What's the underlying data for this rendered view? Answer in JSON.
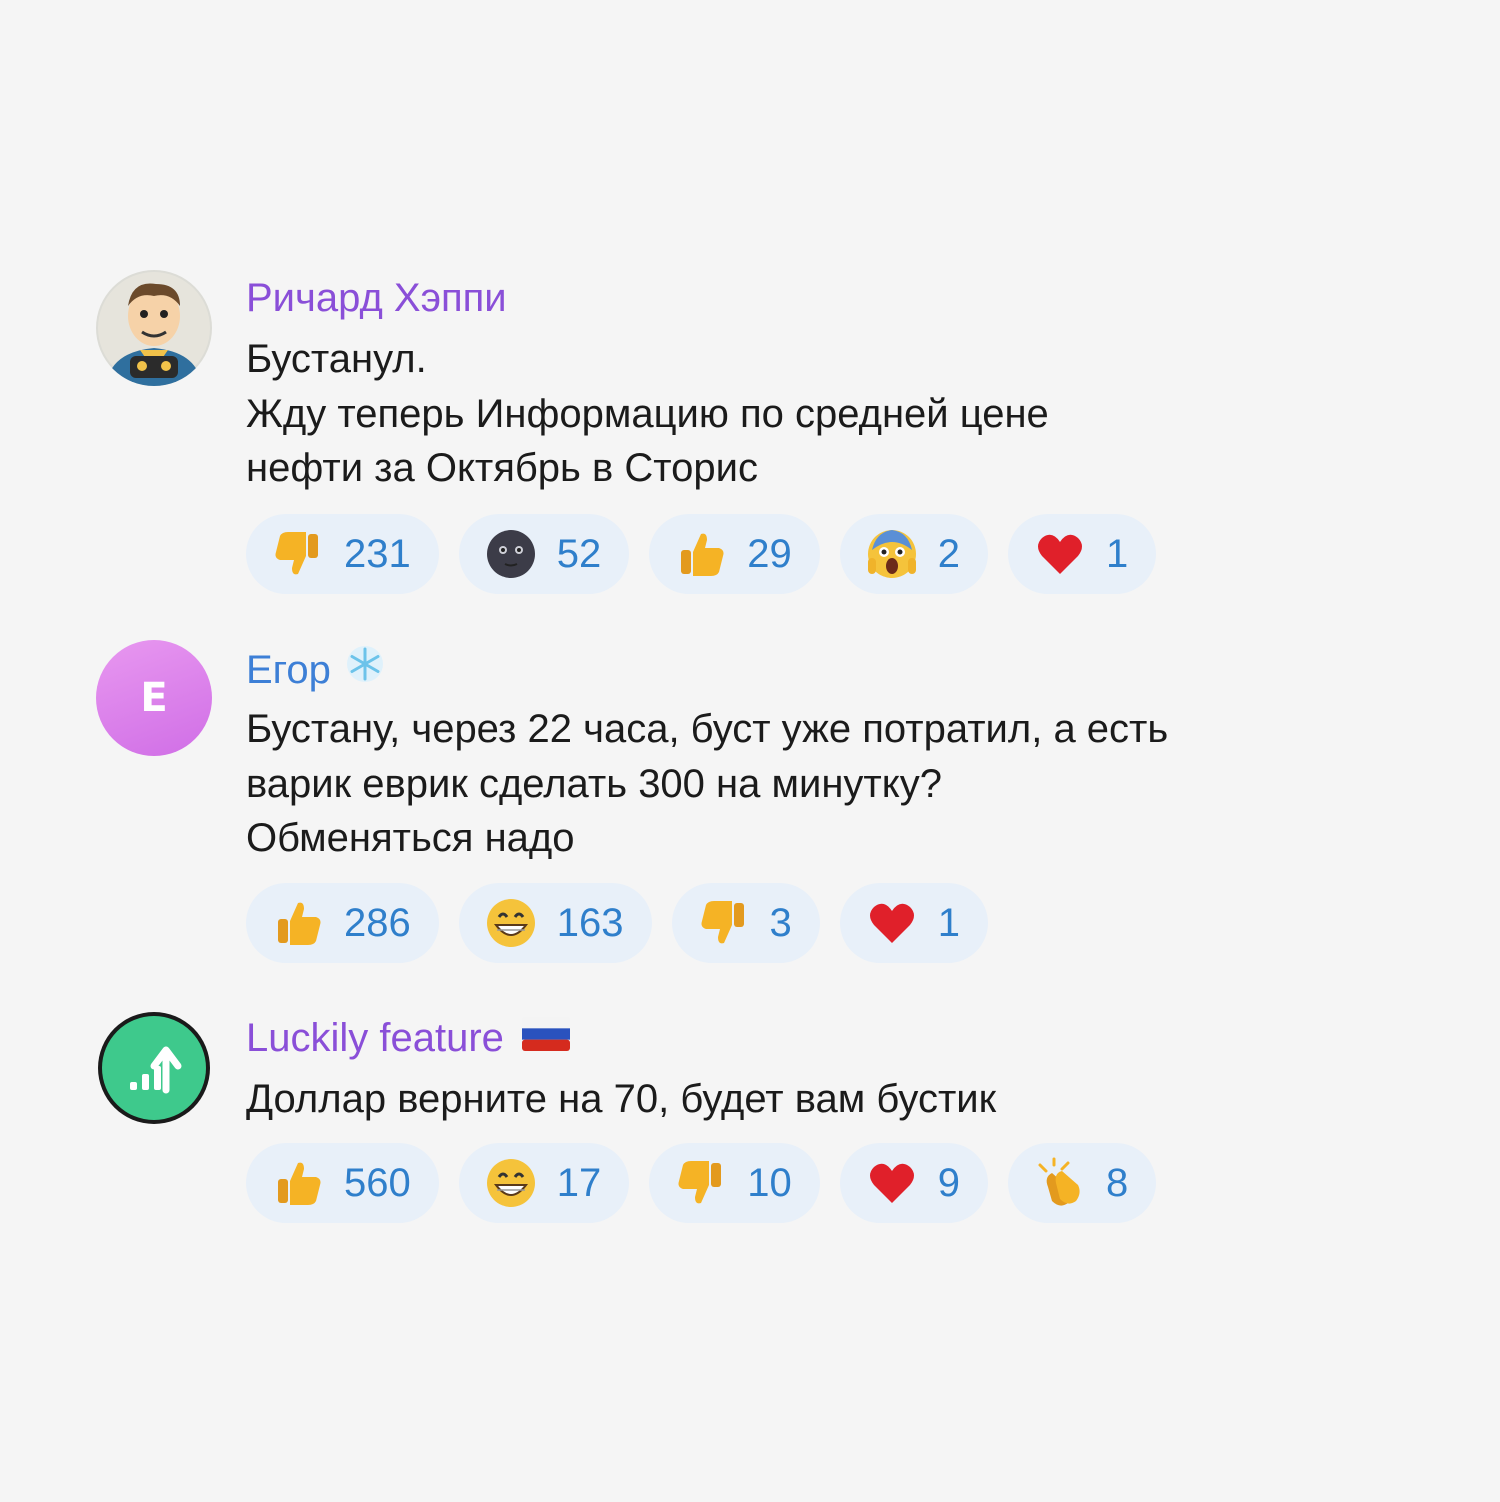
{
  "comments": [
    {
      "author": "Ричард Хэппи",
      "author_color": "#8a4fd8",
      "avatar": "cartoon-character",
      "text": "Бустанул.\nЖду теперь Информацию по средней цене\nнефти за Октябрь в Сторис",
      "reactions": [
        {
          "icon": "thumbs-down",
          "count": "231"
        },
        {
          "icon": "new-moon-face",
          "count": "52"
        },
        {
          "icon": "thumbs-up",
          "count": "29"
        },
        {
          "icon": "screaming-face",
          "count": "2"
        },
        {
          "icon": "red-heart",
          "count": "1"
        }
      ]
    },
    {
      "author": "Егор",
      "author_badge": "snowflake",
      "author_color": "#3d7fd6",
      "avatar": "letter",
      "avatar_letter": "Е",
      "text": "Бустану, через 22 часа, буст уже потратил, а есть\nварик еврик сделать 300 на минутку?\nОбменяться надо",
      "reactions": [
        {
          "icon": "thumbs-up",
          "count": "286"
        },
        {
          "icon": "grinning-face",
          "count": "163"
        },
        {
          "icon": "thumbs-down",
          "count": "3"
        },
        {
          "icon": "red-heart",
          "count": "1"
        }
      ]
    },
    {
      "author": "Luckily feature",
      "author_badge": "russia-flag",
      "author_color": "#8a4fd8",
      "avatar": "chart-arrow",
      "text": "Доллар верните на 70, будет вам бустик",
      "reactions": [
        {
          "icon": "thumbs-up",
          "count": "560"
        },
        {
          "icon": "grinning-face",
          "count": "17"
        },
        {
          "icon": "thumbs-down",
          "count": "10"
        },
        {
          "icon": "red-heart",
          "count": "9"
        },
        {
          "icon": "clapping-hands",
          "count": "8"
        }
      ]
    }
  ]
}
